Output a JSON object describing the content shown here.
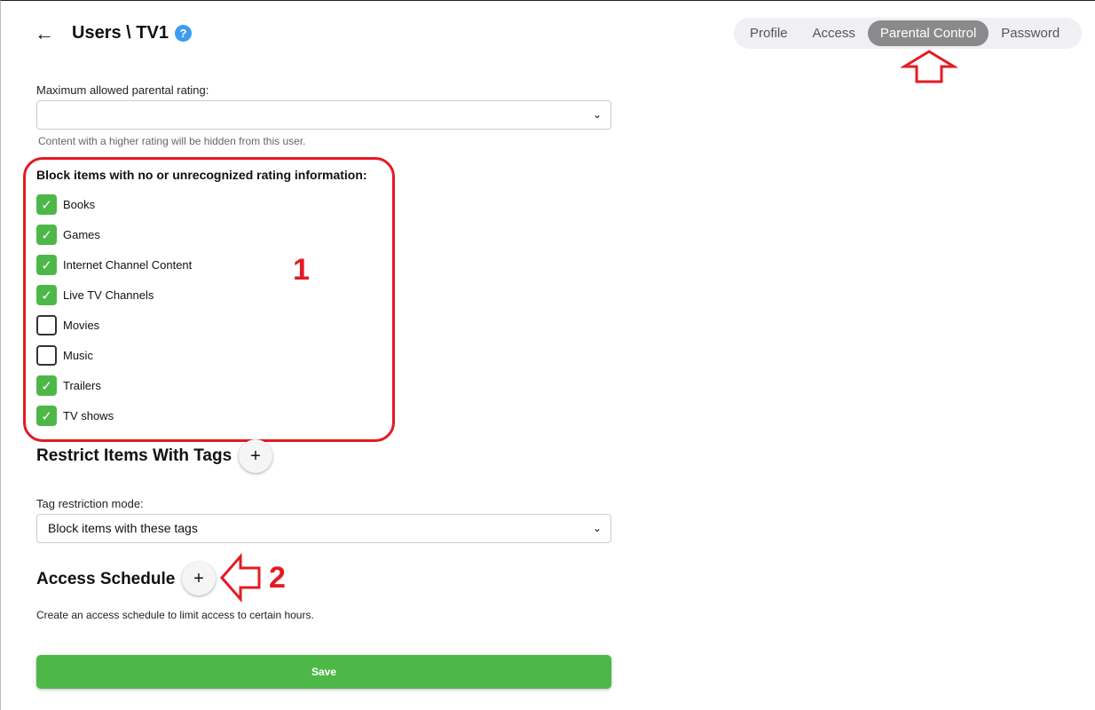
{
  "header": {
    "back_icon": "←",
    "title": "Users \\ TV1",
    "help_icon": "?"
  },
  "tabs": [
    {
      "label": "Profile"
    },
    {
      "label": "Access"
    },
    {
      "label": "Parental Control",
      "active": true
    },
    {
      "label": "Password"
    }
  ],
  "rating": {
    "label": "Maximum allowed parental rating:",
    "value": "",
    "hint": "Content with a higher rating will be hidden from this user."
  },
  "block": {
    "title": "Block items with no or unrecognized rating information:",
    "items": [
      {
        "label": "Books",
        "checked": true
      },
      {
        "label": "Games",
        "checked": true
      },
      {
        "label": "Internet Channel Content",
        "checked": true
      },
      {
        "label": "Live TV Channels",
        "checked": true
      },
      {
        "label": "Movies",
        "checked": false
      },
      {
        "label": "Music",
        "checked": false
      },
      {
        "label": "Trailers",
        "checked": true
      },
      {
        "label": "TV shows",
        "checked": true
      }
    ]
  },
  "tags": {
    "title": "Restrict Items With Tags",
    "add": "+",
    "mode_label": "Tag restriction mode:",
    "mode_value": "Block items with these tags"
  },
  "schedule": {
    "title": "Access Schedule",
    "add": "+",
    "hint": "Create an access schedule to limit access to certain hours."
  },
  "save_label": "Save",
  "annotations": {
    "n1": "1",
    "n2": "2"
  },
  "colors": {
    "accent": "#4db848",
    "annotation": "#e31b23",
    "active_tab": "#8a8a8a"
  }
}
